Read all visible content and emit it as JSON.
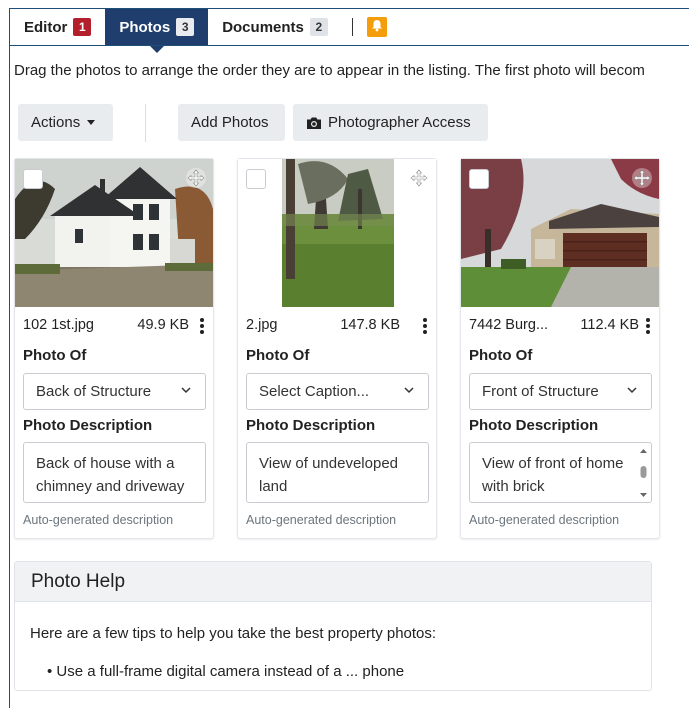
{
  "tabs": [
    {
      "label": "Editor",
      "badge": "1"
    },
    {
      "label": "Photos",
      "badge": "3"
    },
    {
      "label": "Documents",
      "badge": "2"
    }
  ],
  "notification_icon": "bell-icon",
  "instructions": "Drag the photos to arrange the order they are to appear in the listing. The first photo will becom",
  "toolbar": {
    "actions_label": "Actions",
    "add_photos_label": "Add Photos",
    "photographer_access_label": "Photographer Access",
    "photographer_icon": "camera-icon"
  },
  "field_labels": {
    "photo_of": "Photo Of",
    "photo_description": "Photo Description",
    "auto_generated": "Auto-generated description"
  },
  "photos": [
    {
      "filename": "102 1st.jpg",
      "size": "49.9 KB",
      "photo_of": "Back of Structure",
      "description": "Back of house with a chimney and driveway"
    },
    {
      "filename": "2.jpg",
      "size": "147.8 KB",
      "photo_of": "Select Caption...",
      "description": "View of undeveloped land"
    },
    {
      "filename": "7442 Burg...",
      "size": "112.4 KB",
      "photo_of": "Front of Structure",
      "description": "View of front of home with brick"
    }
  ],
  "help": {
    "title": "Photo Help",
    "intro": "Here are a few tips to help you take the best property photos:",
    "first_tip": "Use a full-frame digital camera instead of a ... phone"
  },
  "colors": {
    "active_tab": "#1f3e6e",
    "badge_red": "#b3202b",
    "badge_orange": "#f59e0b",
    "button_bg": "#e9ecef"
  }
}
